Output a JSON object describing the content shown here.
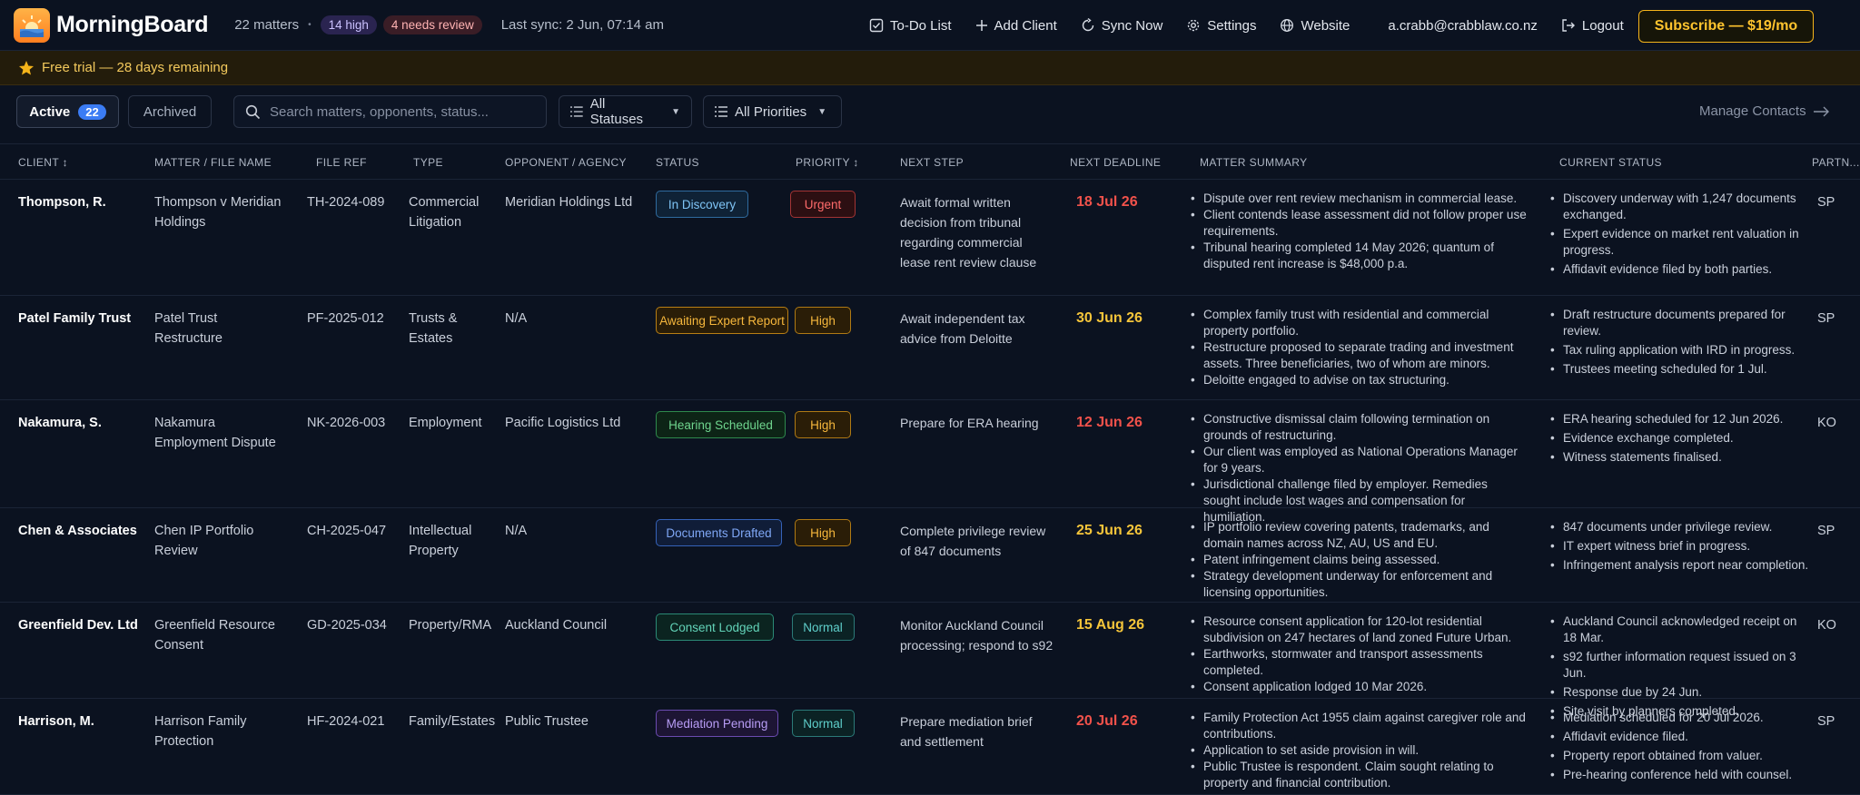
{
  "header": {
    "app_name": "MorningBoard",
    "matters_count": "22 matters",
    "separator": "•",
    "high_badge": "14 high",
    "review_badge": "4 needs review",
    "last_sync": "Last sync: 2 Jun, 07:14 am",
    "nav": {
      "todo": "To-Do List",
      "add_client": "Add Client",
      "sync": "Sync Now",
      "settings": "Settings",
      "website": "Website",
      "email": "a.crabb@crabblaw.co.nz",
      "logout": "Logout"
    },
    "subscribe": "Subscribe — $19/mo"
  },
  "trial": {
    "text": "Free trial — 28 days remaining"
  },
  "toolbar": {
    "tab_active": "Active",
    "tab_active_count": "22",
    "tab_archived": "Archived",
    "search_placeholder": "Search matters, opponents, status...",
    "status_filter": "All Statuses",
    "priority_filter": "All Priorities",
    "manage_contacts": "Manage Contacts"
  },
  "columns": {
    "client": "CLIENT",
    "matter": "MATTER / FILE NAME",
    "file_ref": "FILE REF",
    "type": "TYPE",
    "opponent": "OPPONENT / AGENCY",
    "status": "STATUS",
    "priority": "PRIORITY",
    "next_step": "NEXT STEP",
    "deadline": "NEXT DEADLINE",
    "summary": "MATTER SUMMARY",
    "current": "CURRENT STATUS",
    "partner": "PARTN..."
  },
  "colors": {
    "accent": "#3b7cf4",
    "subscribe": "#f5b41a",
    "deadline_red": "#f2524b",
    "deadline_amber": "#f5c53a"
  },
  "rows": [
    {
      "client": "Thompson, R.",
      "matter": "Thompson v Meridian Holdings",
      "file_ref": "TH-2024-089",
      "type": "Commercial Litigation",
      "opponent": "Meridian Holdings Ltd",
      "status": "In Discovery",
      "priority": "Urgent",
      "next_step": "Await formal written decision from tribunal regarding commercial lease rent review clause",
      "deadline": "18 Jul 26",
      "summary": [
        "Dispute over rent review mechanism in commercial lease.",
        "Client contends lease assessment did not follow proper use requirements.",
        "Tribunal hearing completed 14 May 2026; quantum of disputed rent increase is $48,000 p.a."
      ],
      "current": [
        "Discovery underway with 1,247 documents exchanged.",
        "Expert evidence on market rent valuation in progress.",
        "Affidavit evidence filed by both parties."
      ],
      "partner": "SP"
    },
    {
      "client": "Patel Family Trust",
      "matter": "Patel Trust Restructure",
      "file_ref": "PF-2025-012",
      "type": "Trusts & Estates",
      "opponent": "N/A",
      "status": "Awaiting Expert Report",
      "priority": "High",
      "next_step": "Await independent tax advice from Deloitte",
      "deadline": "30 Jun 26",
      "summary": [
        "Complex family trust with residential and commercial property portfolio.",
        "Restructure proposed to separate trading and investment assets. Three beneficiaries, two of whom are minors.",
        "Deloitte engaged to advise on tax structuring."
      ],
      "current": [
        "Draft restructure documents prepared for review.",
        "Tax ruling application with IRD in progress.",
        "Trustees meeting scheduled for 1 Jul."
      ],
      "partner": "SP"
    },
    {
      "client": "Nakamura, S.",
      "matter": "Nakamura Employment Dispute",
      "file_ref": "NK-2026-003",
      "type": "Employment",
      "opponent": "Pacific Logistics Ltd",
      "status": "Hearing Scheduled",
      "priority": "High",
      "next_step": "Prepare for ERA hearing",
      "deadline": "12 Jun 26",
      "summary": [
        "Constructive dismissal claim following termination on grounds of restructuring.",
        "Our client was employed as National Operations Manager for 9 years.",
        "Jurisdictional challenge filed by employer. Remedies sought include lost wages and compensation for humiliation."
      ],
      "current": [
        "ERA hearing scheduled for 12 Jun 2026.",
        "Evidence exchange completed.",
        "Witness statements finalised."
      ],
      "partner": "KO"
    },
    {
      "client": "Chen & Associates",
      "matter": "Chen IP Portfolio Review",
      "file_ref": "CH-2025-047",
      "type": "Intellectual Property",
      "opponent": "N/A",
      "status": "Documents Drafted",
      "priority": "High",
      "next_step": "Complete privilege review of 847 documents",
      "deadline": "25 Jun 26",
      "summary": [
        "IP portfolio review covering patents, trademarks, and domain names across NZ, AU, US and EU.",
        "Patent infringement claims being assessed.",
        "Strategy development underway for enforcement and licensing opportunities."
      ],
      "current": [
        "847 documents under privilege review.",
        "IT expert witness brief in progress.",
        "Infringement analysis report near completion."
      ],
      "partner": "SP"
    },
    {
      "client": "Greenfield Dev. Ltd",
      "matter": "Greenfield Resource Consent",
      "file_ref": "GD-2025-034",
      "type": "Property/RMA",
      "opponent": "Auckland Council",
      "status": "Consent Lodged",
      "priority": "Normal",
      "next_step": "Monitor Auckland Council processing; respond to s92",
      "deadline": "15 Aug 26",
      "summary": [
        "Resource consent application for 120-lot residential subdivision on 247 hectares of land zoned Future Urban.",
        "Earthworks, stormwater and transport assessments completed.",
        "Consent application lodged 10 Mar 2026."
      ],
      "current": [
        "Auckland Council acknowledged receipt on 18 Mar.",
        "s92 further information request issued on 3 Jun.",
        "Response due by 24 Jun.",
        "Site visit by planners completed."
      ],
      "partner": "KO"
    },
    {
      "client": "Harrison, M.",
      "matter": "Harrison Family Protection",
      "file_ref": "HF-2024-021",
      "type": "Family/Estates",
      "opponent": "Public Trustee",
      "status": "Mediation Pending",
      "priority": "Normal",
      "next_step": "Prepare mediation brief and settlement",
      "deadline": "20 Jul 26",
      "summary": [
        "Family Protection Act 1955 claim against caregiver role and contributions.",
        "Application to set aside provision in will.",
        "Public Trustee is respondent. Claim sought relating to property and financial contribution."
      ],
      "current": [
        "Mediation scheduled for 20 Jul 2026.",
        "Affidavit evidence filed.",
        "Property report obtained from valuer.",
        "Pre-hearing conference held with counsel."
      ],
      "partner": "SP"
    }
  ]
}
